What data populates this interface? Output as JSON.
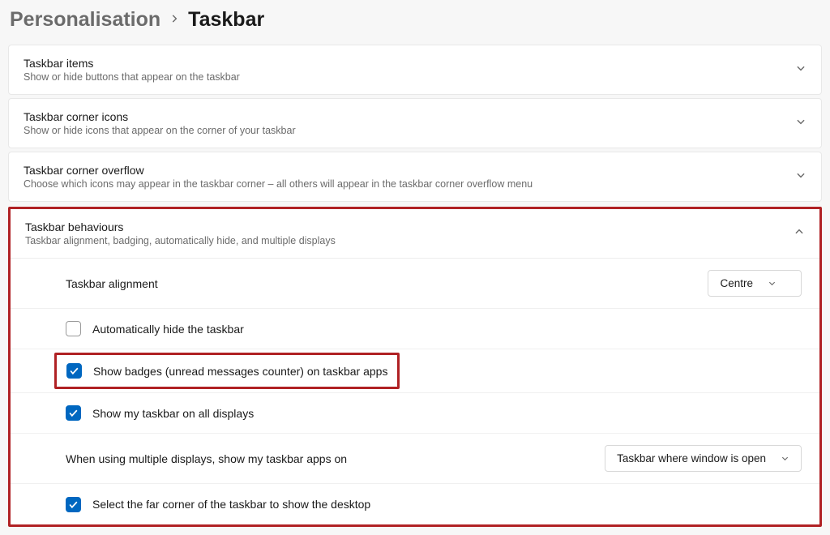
{
  "breadcrumb": {
    "parent": "Personalisation",
    "current": "Taskbar"
  },
  "panels": {
    "items": {
      "title": "Taskbar items",
      "subtitle": "Show or hide buttons that appear on the taskbar"
    },
    "cornerIcons": {
      "title": "Taskbar corner icons",
      "subtitle": "Show or hide icons that appear on the corner of your taskbar"
    },
    "cornerOverflow": {
      "title": "Taskbar corner overflow",
      "subtitle": "Choose which icons may appear in the taskbar corner – all others will appear in the taskbar corner overflow menu"
    },
    "behaviours": {
      "title": "Taskbar behaviours",
      "subtitle": "Taskbar alignment, badging, automatically hide, and multiple displays"
    }
  },
  "settings": {
    "alignment": {
      "label": "Taskbar alignment",
      "value": "Centre"
    },
    "autoHide": {
      "label": "Automatically hide the taskbar",
      "checked": false
    },
    "badges": {
      "label": "Show badges (unread messages counter) on taskbar apps",
      "checked": true
    },
    "allDisplays": {
      "label": "Show my taskbar on all displays",
      "checked": true
    },
    "multiDisplay": {
      "label": "When using multiple displays, show my taskbar apps on",
      "value": "Taskbar where window is open"
    },
    "farCorner": {
      "label": "Select the far corner of the taskbar to show the desktop",
      "checked": true
    }
  }
}
